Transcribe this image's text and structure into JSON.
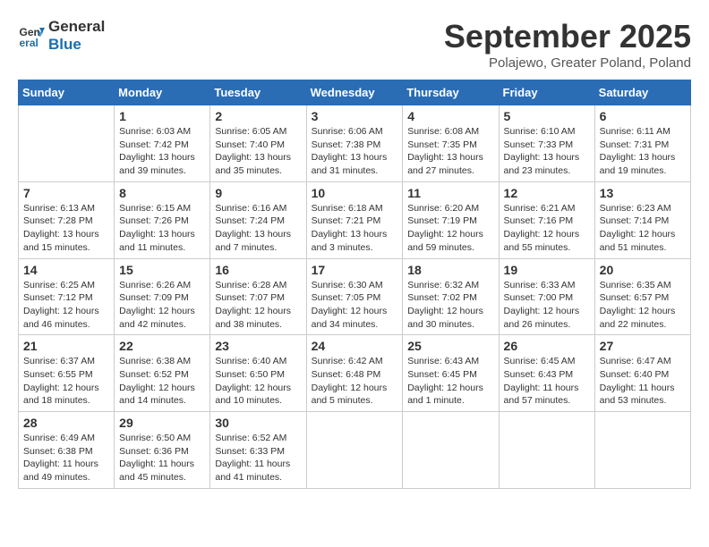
{
  "header": {
    "logo_line1": "General",
    "logo_line2": "Blue",
    "month": "September 2025",
    "location": "Polajewo, Greater Poland, Poland"
  },
  "weekdays": [
    "Sunday",
    "Monday",
    "Tuesday",
    "Wednesday",
    "Thursday",
    "Friday",
    "Saturday"
  ],
  "weeks": [
    [
      {
        "day": "",
        "info": ""
      },
      {
        "day": "1",
        "info": "Sunrise: 6:03 AM\nSunset: 7:42 PM\nDaylight: 13 hours\nand 39 minutes."
      },
      {
        "day": "2",
        "info": "Sunrise: 6:05 AM\nSunset: 7:40 PM\nDaylight: 13 hours\nand 35 minutes."
      },
      {
        "day": "3",
        "info": "Sunrise: 6:06 AM\nSunset: 7:38 PM\nDaylight: 13 hours\nand 31 minutes."
      },
      {
        "day": "4",
        "info": "Sunrise: 6:08 AM\nSunset: 7:35 PM\nDaylight: 13 hours\nand 27 minutes."
      },
      {
        "day": "5",
        "info": "Sunrise: 6:10 AM\nSunset: 7:33 PM\nDaylight: 13 hours\nand 23 minutes."
      },
      {
        "day": "6",
        "info": "Sunrise: 6:11 AM\nSunset: 7:31 PM\nDaylight: 13 hours\nand 19 minutes."
      }
    ],
    [
      {
        "day": "7",
        "info": "Sunrise: 6:13 AM\nSunset: 7:28 PM\nDaylight: 13 hours\nand 15 minutes."
      },
      {
        "day": "8",
        "info": "Sunrise: 6:15 AM\nSunset: 7:26 PM\nDaylight: 13 hours\nand 11 minutes."
      },
      {
        "day": "9",
        "info": "Sunrise: 6:16 AM\nSunset: 7:24 PM\nDaylight: 13 hours\nand 7 minutes."
      },
      {
        "day": "10",
        "info": "Sunrise: 6:18 AM\nSunset: 7:21 PM\nDaylight: 13 hours\nand 3 minutes."
      },
      {
        "day": "11",
        "info": "Sunrise: 6:20 AM\nSunset: 7:19 PM\nDaylight: 12 hours\nand 59 minutes."
      },
      {
        "day": "12",
        "info": "Sunrise: 6:21 AM\nSunset: 7:16 PM\nDaylight: 12 hours\nand 55 minutes."
      },
      {
        "day": "13",
        "info": "Sunrise: 6:23 AM\nSunset: 7:14 PM\nDaylight: 12 hours\nand 51 minutes."
      }
    ],
    [
      {
        "day": "14",
        "info": "Sunrise: 6:25 AM\nSunset: 7:12 PM\nDaylight: 12 hours\nand 46 minutes."
      },
      {
        "day": "15",
        "info": "Sunrise: 6:26 AM\nSunset: 7:09 PM\nDaylight: 12 hours\nand 42 minutes."
      },
      {
        "day": "16",
        "info": "Sunrise: 6:28 AM\nSunset: 7:07 PM\nDaylight: 12 hours\nand 38 minutes."
      },
      {
        "day": "17",
        "info": "Sunrise: 6:30 AM\nSunset: 7:05 PM\nDaylight: 12 hours\nand 34 minutes."
      },
      {
        "day": "18",
        "info": "Sunrise: 6:32 AM\nSunset: 7:02 PM\nDaylight: 12 hours\nand 30 minutes."
      },
      {
        "day": "19",
        "info": "Sunrise: 6:33 AM\nSunset: 7:00 PM\nDaylight: 12 hours\nand 26 minutes."
      },
      {
        "day": "20",
        "info": "Sunrise: 6:35 AM\nSunset: 6:57 PM\nDaylight: 12 hours\nand 22 minutes."
      }
    ],
    [
      {
        "day": "21",
        "info": "Sunrise: 6:37 AM\nSunset: 6:55 PM\nDaylight: 12 hours\nand 18 minutes."
      },
      {
        "day": "22",
        "info": "Sunrise: 6:38 AM\nSunset: 6:52 PM\nDaylight: 12 hours\nand 14 minutes."
      },
      {
        "day": "23",
        "info": "Sunrise: 6:40 AM\nSunset: 6:50 PM\nDaylight: 12 hours\nand 10 minutes."
      },
      {
        "day": "24",
        "info": "Sunrise: 6:42 AM\nSunset: 6:48 PM\nDaylight: 12 hours\nand 5 minutes."
      },
      {
        "day": "25",
        "info": "Sunrise: 6:43 AM\nSunset: 6:45 PM\nDaylight: 12 hours\nand 1 minute."
      },
      {
        "day": "26",
        "info": "Sunrise: 6:45 AM\nSunset: 6:43 PM\nDaylight: 11 hours\nand 57 minutes."
      },
      {
        "day": "27",
        "info": "Sunrise: 6:47 AM\nSunset: 6:40 PM\nDaylight: 11 hours\nand 53 minutes."
      }
    ],
    [
      {
        "day": "28",
        "info": "Sunrise: 6:49 AM\nSunset: 6:38 PM\nDaylight: 11 hours\nand 49 minutes."
      },
      {
        "day": "29",
        "info": "Sunrise: 6:50 AM\nSunset: 6:36 PM\nDaylight: 11 hours\nand 45 minutes."
      },
      {
        "day": "30",
        "info": "Sunrise: 6:52 AM\nSunset: 6:33 PM\nDaylight: 11 hours\nand 41 minutes."
      },
      {
        "day": "",
        "info": ""
      },
      {
        "day": "",
        "info": ""
      },
      {
        "day": "",
        "info": ""
      },
      {
        "day": "",
        "info": ""
      }
    ]
  ]
}
